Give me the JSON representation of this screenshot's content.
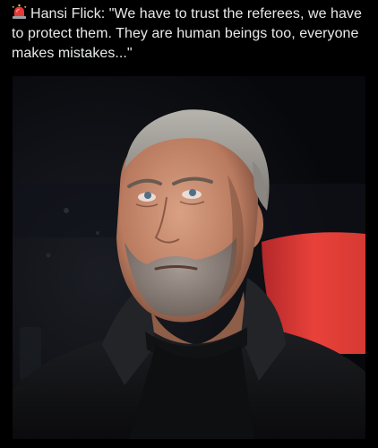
{
  "post": {
    "alert_icon": "rotating-light-emoji",
    "text": "Hansi Flick: \"We have to trust the referees, we have to protect them. They are human beings too, everyone makes mistakes...\""
  },
  "media": {
    "type": "photo"
  },
  "colors": {
    "background": "#000000",
    "text": "#e7e9ea",
    "siren_red": "#e53935",
    "backdrop_red": "#e8413a"
  }
}
